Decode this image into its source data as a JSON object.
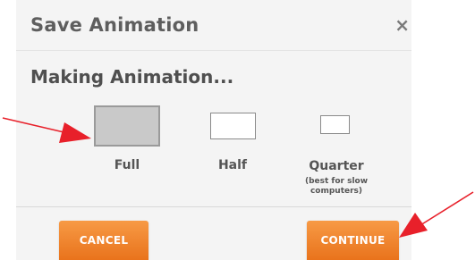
{
  "dialog": {
    "title": "Save Animation",
    "close_glyph": "×",
    "subtitle": "Making Animation..."
  },
  "sizes": [
    {
      "label": "Full",
      "selected": true
    },
    {
      "label": "Half",
      "selected": false
    },
    {
      "label": "Quarter",
      "note_line1": "(best for slow",
      "note_line2": "computers)",
      "selected": false
    }
  ],
  "buttons": {
    "cancel_label": "CANCEL",
    "continue_label": "CONTINUE"
  },
  "colors": {
    "accent_orange": "#ee7f2a",
    "annotation_red": "#e8202a"
  }
}
